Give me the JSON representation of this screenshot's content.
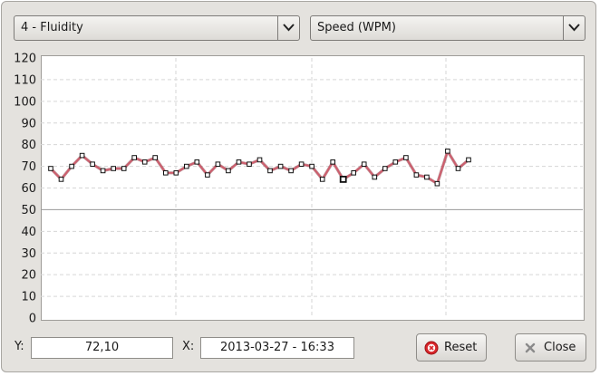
{
  "metric_select": {
    "selected": "4 - Fluidity"
  },
  "unit_select": {
    "selected": "Speed (WPM)"
  },
  "readout": {
    "y_label": "Y:",
    "y_value": "72,10",
    "x_label": "X:",
    "x_value": "2013-03-27 - 16:33"
  },
  "buttons": {
    "reset_label": "Reset",
    "reset_icon": "red-circle-x-icon",
    "close_label": "Close",
    "close_icon": "gray-x-icon"
  },
  "colors": {
    "series_line": "#d05a6a",
    "reference_line": "#9a9a9a",
    "grid": "#d6d6d6"
  },
  "chart_data": {
    "type": "line",
    "title": "",
    "xlabel": "",
    "ylabel": "",
    "ylim": [
      0,
      120
    ],
    "yticks": [
      "0",
      "10",
      "20",
      "30",
      "40",
      "50",
      "60",
      "70",
      "80",
      "90",
      "100",
      "110",
      "120"
    ],
    "reference_line_y": 50,
    "grid": true,
    "highlighted_point_index": 28,
    "series": [
      {
        "values": [
          69,
          64,
          70,
          75,
          71,
          68,
          69,
          69,
          74,
          72,
          74,
          67,
          67,
          70,
          72,
          66,
          71,
          68,
          72,
          71,
          73,
          68,
          70,
          68,
          71,
          70,
          64,
          72,
          64,
          67,
          71,
          65,
          69,
          72,
          74,
          66,
          65,
          62,
          77,
          69,
          73
        ]
      }
    ]
  }
}
